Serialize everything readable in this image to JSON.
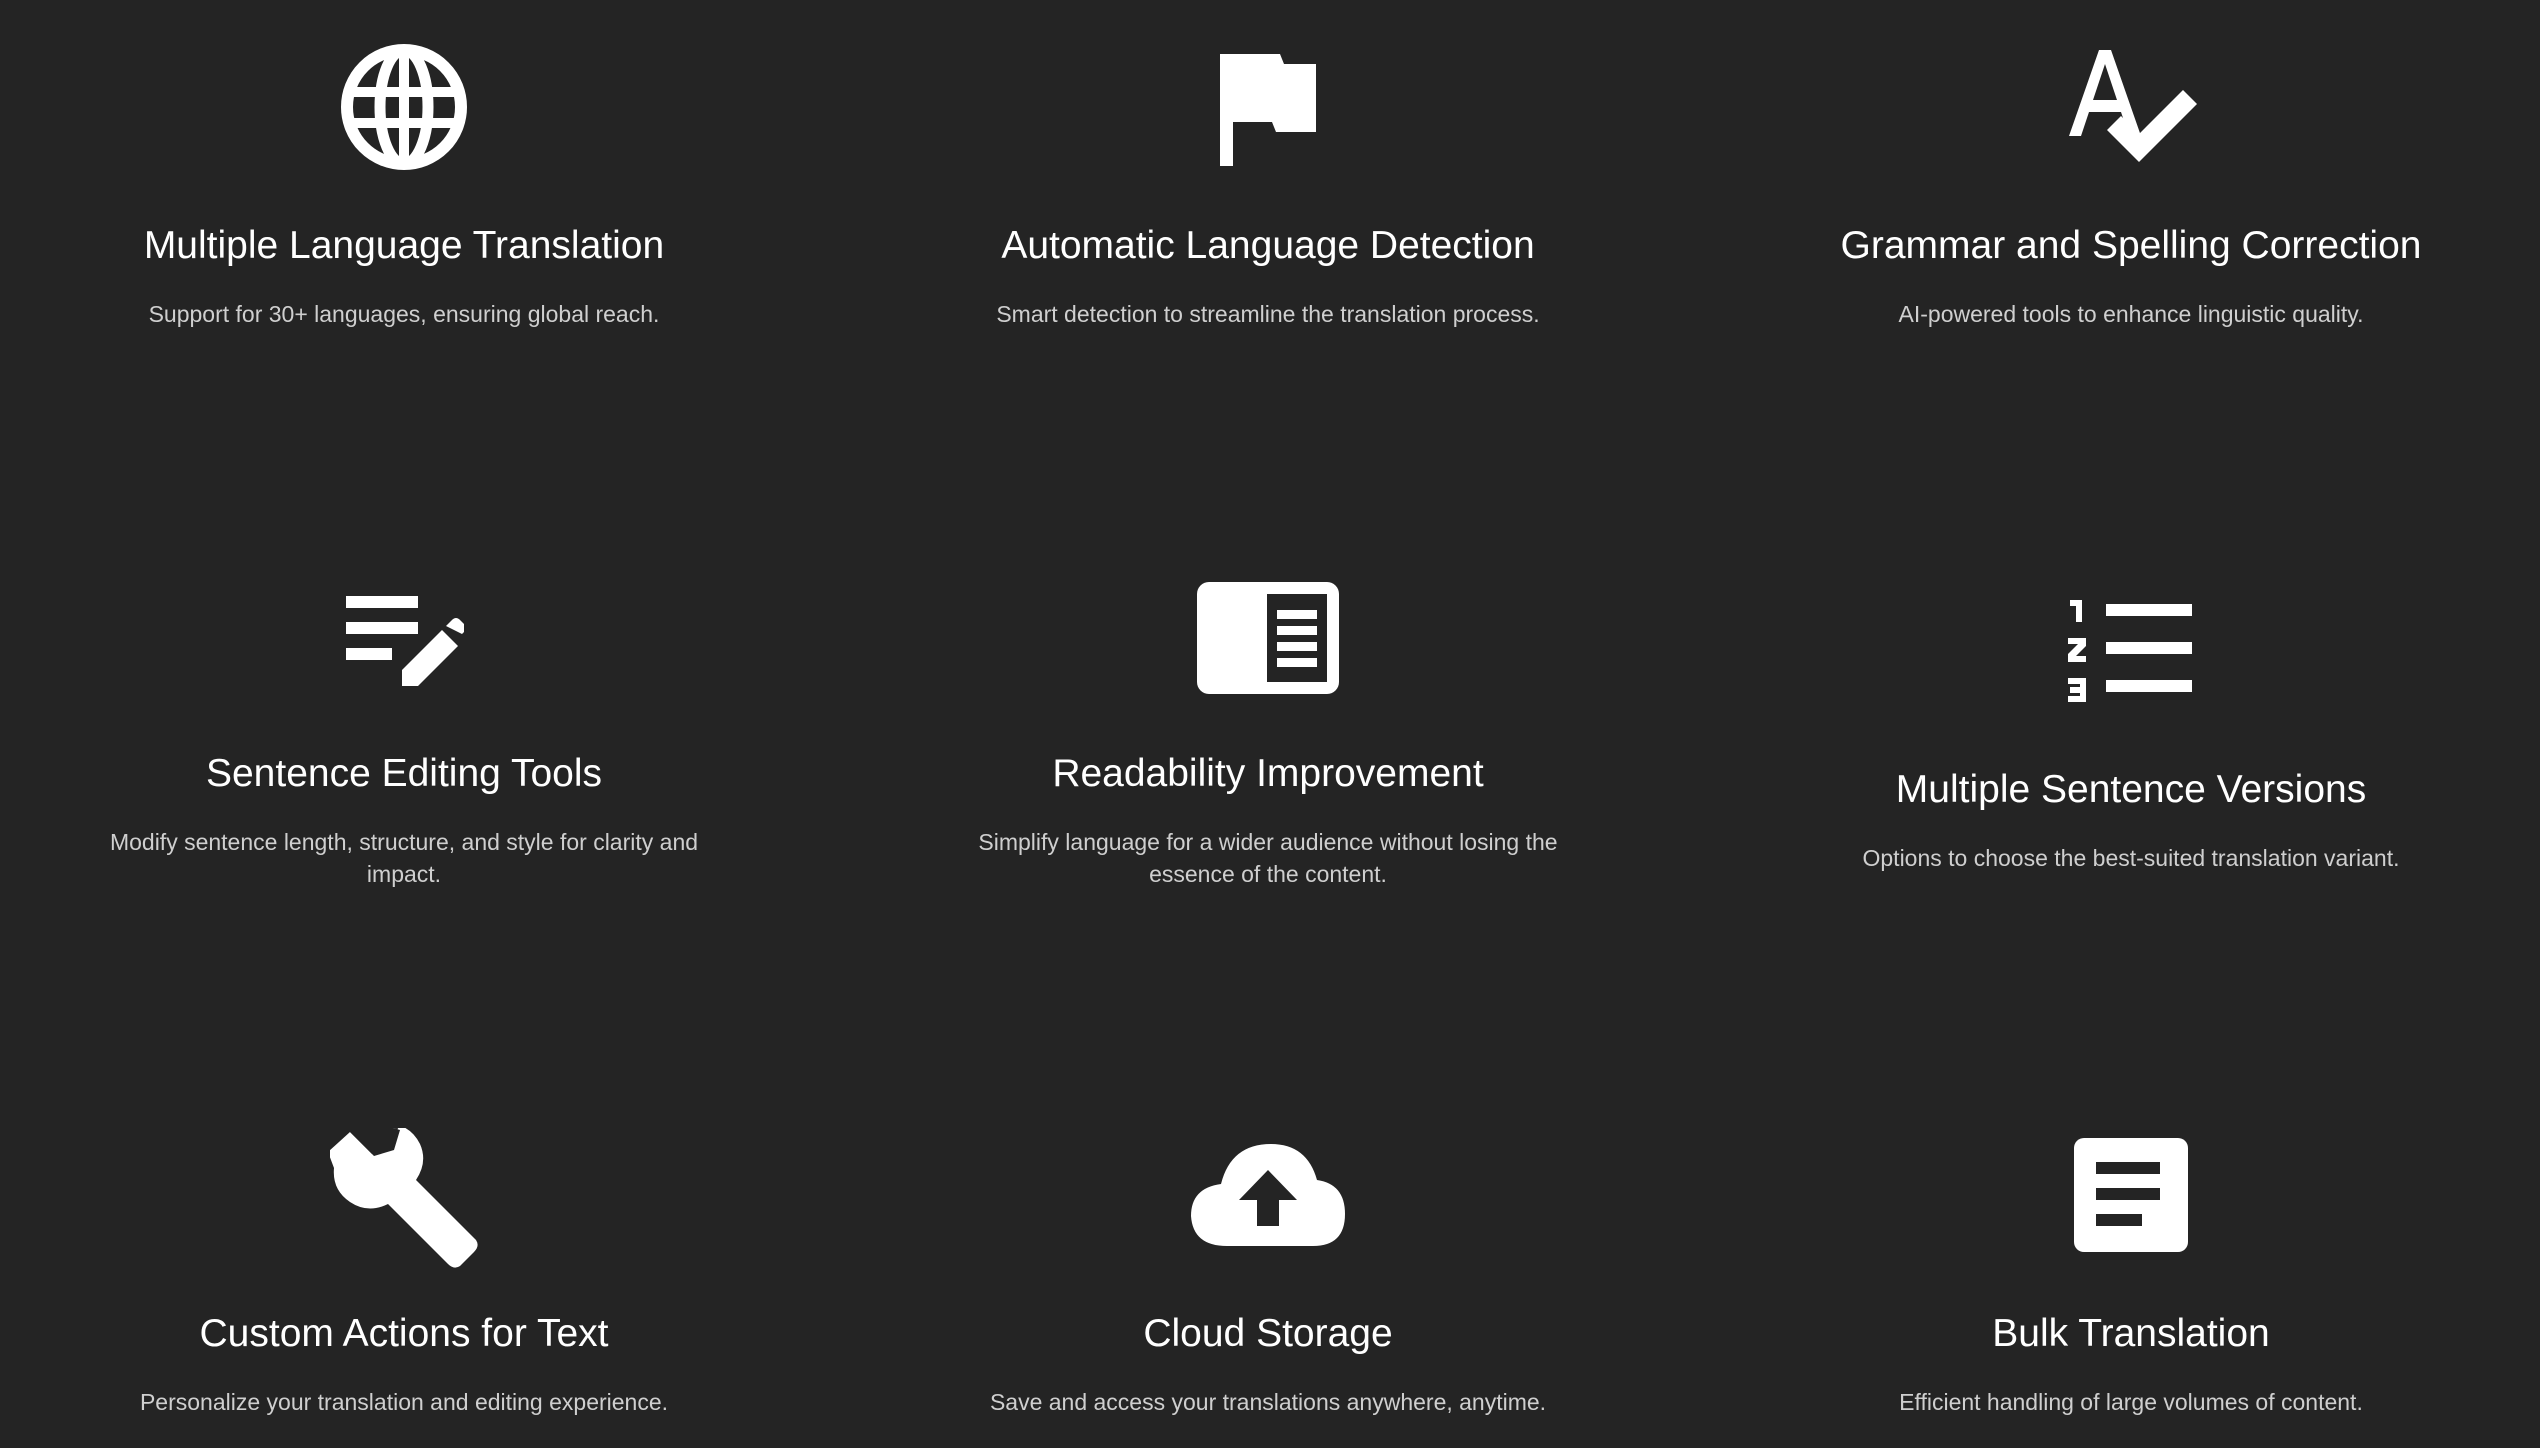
{
  "colors": {
    "background": "#242424",
    "title": "#ffffff",
    "description": "#cfcfcf",
    "icon": "#ffffff"
  },
  "features": [
    {
      "icon": "globe-icon",
      "title": "Multiple Language Translation",
      "description": "Support for 30+ languages, ensuring global reach."
    },
    {
      "icon": "flag-icon",
      "title": "Automatic Language Detection",
      "description": "Smart detection to streamline the translation process."
    },
    {
      "icon": "spellcheck-icon",
      "title": "Grammar and Spelling Correction",
      "description": "AI-powered tools to enhance linguistic quality."
    },
    {
      "icon": "edit-note-icon",
      "title": "Sentence Editing Tools",
      "description": "Modify sentence length, structure, and style for clarity and impact."
    },
    {
      "icon": "reader-mode-icon",
      "title": "Readability Improvement",
      "description": "Simplify language for a wider audience without losing the essence of the content."
    },
    {
      "icon": "numbered-list-icon",
      "title": "Multiple Sentence Versions",
      "description": "Options to choose the best-suited translation variant."
    },
    {
      "icon": "wrench-icon",
      "title": "Custom Actions for Text",
      "description": "Personalize your translation and editing experience."
    },
    {
      "icon": "cloud-upload-icon",
      "title": "Cloud Storage",
      "description": "Save and access your translations anywhere, anytime."
    },
    {
      "icon": "document-icon",
      "title": "Bulk Translation",
      "description": "Efficient handling of large volumes of content."
    }
  ]
}
